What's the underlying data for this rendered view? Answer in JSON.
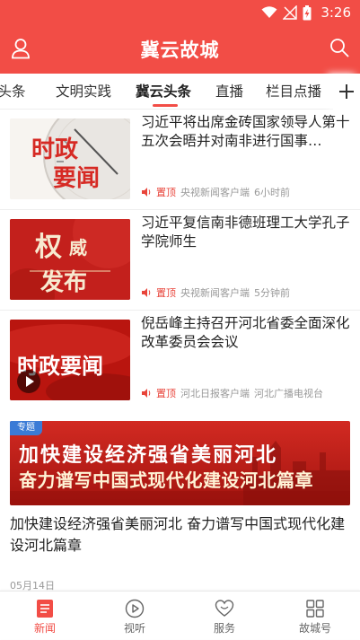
{
  "status_bar": {
    "time": "3:26"
  },
  "header": {
    "title": "冀云故城"
  },
  "tabs": [
    {
      "label": "冀头条"
    },
    {
      "label": "文明实践"
    },
    {
      "label": "冀云头条"
    },
    {
      "label": "直播"
    },
    {
      "label": "栏目点播"
    }
  ],
  "active_tab": "冀云头条",
  "news": [
    {
      "headline": "习近平将出席金砖国家领导人第十五次会晤并对南非进行国事…",
      "thumb_text": [
        "时政",
        "要闻"
      ],
      "top_label": "置顶",
      "source": "央视新闻客户端",
      "time": "6小时前"
    },
    {
      "headline": "习近平复信南非德班理工大学孔子学院师生",
      "thumb_text": [
        "权",
        "威",
        "发布"
      ],
      "top_label": "置顶",
      "source": "央视新闻客户端",
      "time": "5分钟前"
    },
    {
      "headline": "倪岳峰主持召开河北省委全面深化改革委员会会议",
      "thumb_text": [
        "时政要闻"
      ],
      "top_label": "置顶",
      "source": "河北日报客户端",
      "time": "河北广播电视台"
    }
  ],
  "banner": {
    "badge": "专题",
    "line1": "加快建设经济强省美丽河北",
    "line2": "奋力谱写中国式现代化建设河北篇章",
    "title": "加快建设经济强省美丽河北 奋力谱写中国式现代化建设河北篇章",
    "date": "05月14日"
  },
  "bottom_nav": [
    {
      "label": "新闻",
      "icon": "news-icon"
    },
    {
      "label": "视听",
      "icon": "play-icon"
    },
    {
      "label": "服务",
      "icon": "heart-icon"
    },
    {
      "label": "故城号",
      "icon": "grid-icon"
    }
  ],
  "colors": {
    "brand": "#f24d46",
    "top_label": "#e8443a",
    "banner_blue": "#3b7bd6"
  }
}
